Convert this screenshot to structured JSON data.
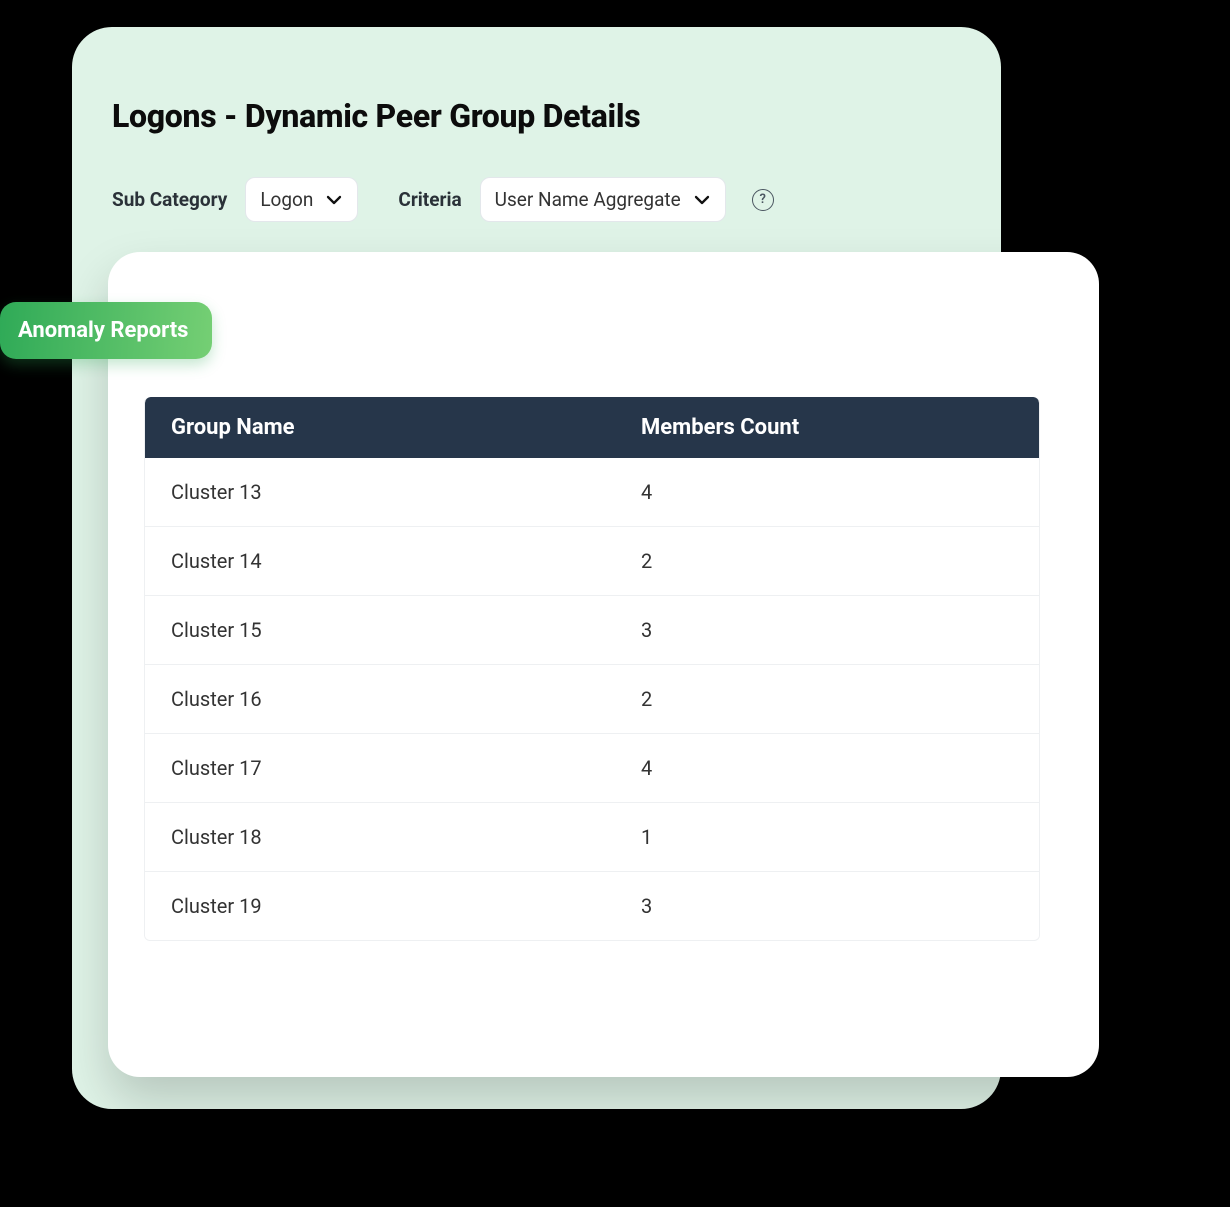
{
  "page": {
    "title": "Logons - Dynamic Peer Group Details"
  },
  "filters": {
    "sub_category_label": "Sub Category",
    "sub_category_value": "Logon",
    "criteria_label": "Criteria",
    "criteria_value": "User Name Aggregate",
    "help_text": "?"
  },
  "badge": {
    "label": "Anomaly Reports"
  },
  "table": {
    "headers": {
      "group_name": "Group Name",
      "members_count": "Members Count"
    },
    "rows": [
      {
        "group_name": "Cluster 13",
        "members_count": "4"
      },
      {
        "group_name": "Cluster 14",
        "members_count": "2"
      },
      {
        "group_name": "Cluster 15",
        "members_count": "3"
      },
      {
        "group_name": "Cluster 16",
        "members_count": "2"
      },
      {
        "group_name": "Cluster 17",
        "members_count": "4"
      },
      {
        "group_name": "Cluster 18",
        "members_count": "1"
      },
      {
        "group_name": "Cluster 19",
        "members_count": "3"
      }
    ]
  }
}
